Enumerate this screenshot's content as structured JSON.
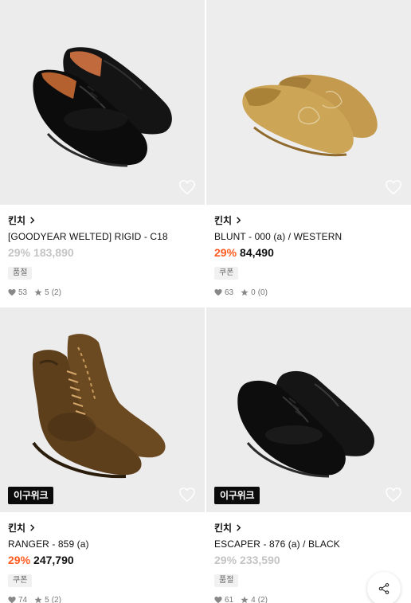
{
  "colors": {
    "discount": "#ff5a1f",
    "soldout": "#c4c4c4",
    "badge_bg": "#0b0b0b"
  },
  "products": [
    {
      "brand": "킨치",
      "name": "[GOODYEAR WELTED] RIGID - C18",
      "discount": "29%",
      "price": "183,890",
      "tag": "품절",
      "likes": "53",
      "rating": "5",
      "reviews": "(2)",
      "badge": "",
      "soldout": true,
      "image_icon": "black-derby-shoes"
    },
    {
      "brand": "킨치",
      "name": "BLUNT - 000 (a) / WESTERN",
      "discount": "29%",
      "price": "84,490",
      "tag": "쿠폰",
      "likes": "63",
      "rating": "0",
      "reviews": "(0)",
      "badge": "",
      "soldout": false,
      "image_icon": "tan-suede-mules"
    },
    {
      "brand": "킨치",
      "name": "RANGER - 859 (a)",
      "discount": "29%",
      "price": "247,790",
      "tag": "쿠폰",
      "likes": "74",
      "rating": "5",
      "reviews": "(2)",
      "badge": "이구위크",
      "soldout": false,
      "image_icon": "brown-suede-boots"
    },
    {
      "brand": "킨치",
      "name": "ESCAPER - 876 (a) / BLACK",
      "discount": "29%",
      "price": "233,590",
      "tag": "품절",
      "likes": "61",
      "rating": "4",
      "reviews": "(2)",
      "badge": "이구위크",
      "soldout": true,
      "image_icon": "black-leather-derby"
    }
  ]
}
